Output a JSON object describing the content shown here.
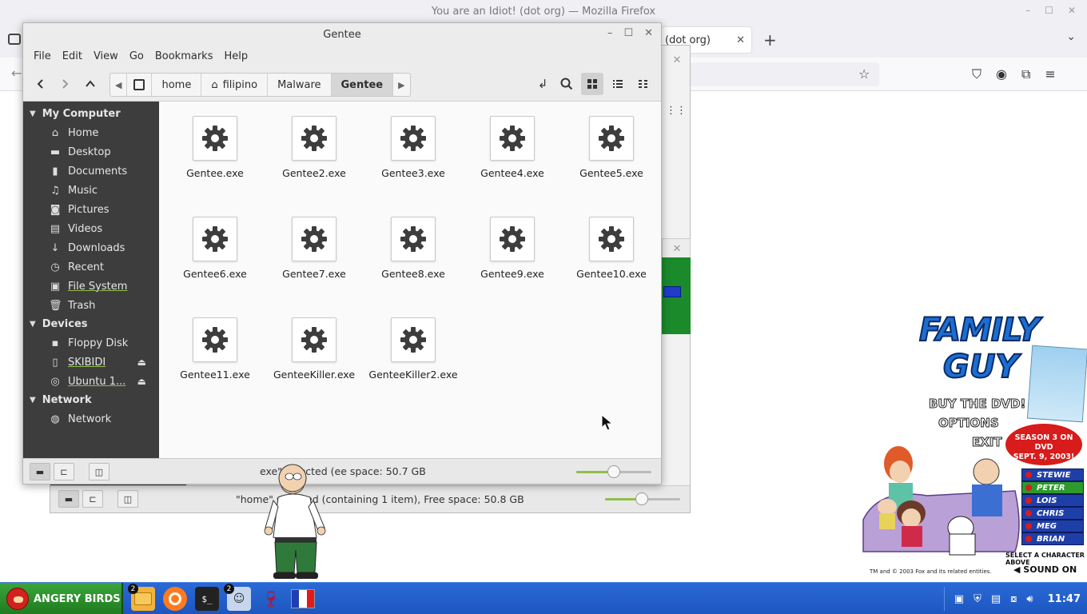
{
  "firefox": {
    "title": "You are an Idiot! (dot org) — Mozilla Firefox",
    "tab_label": "(dot org)",
    "win_controls": [
      "–",
      "☐",
      "✕"
    ]
  },
  "background_fm": {
    "status": "\"home\" selected (containing 1 item), Free space: 50.8 GB"
  },
  "fm": {
    "title": "Gentee",
    "menu": [
      "File",
      "Edit",
      "View",
      "Go",
      "Bookmarks",
      "Help"
    ],
    "breadcrumbs": [
      "home",
      "filipino",
      "Malware",
      "Gentee"
    ],
    "sidebar": {
      "sections": [
        {
          "title": "My Computer",
          "items": [
            {
              "label": "Home",
              "icon": "home-icon"
            },
            {
              "label": "Desktop",
              "icon": "desktop-icon"
            },
            {
              "label": "Documents",
              "icon": "document-icon"
            },
            {
              "label": "Music",
              "icon": "music-icon"
            },
            {
              "label": "Pictures",
              "icon": "camera-icon"
            },
            {
              "label": "Videos",
              "icon": "film-icon"
            },
            {
              "label": "Downloads",
              "icon": "download-icon"
            },
            {
              "label": "Recent",
              "icon": "clock-icon"
            },
            {
              "label": "File System",
              "icon": "drive-icon"
            },
            {
              "label": "Trash",
              "icon": "trash-icon"
            }
          ]
        },
        {
          "title": "Devices",
          "items": [
            {
              "label": "Floppy Disk",
              "icon": "floppy-icon"
            },
            {
              "label": "SKIBIDI",
              "icon": "usb-icon"
            },
            {
              "label": "Ubuntu 1...",
              "icon": "disc-icon"
            }
          ]
        },
        {
          "title": "Network",
          "items": [
            {
              "label": "Network",
              "icon": "globe-icon"
            }
          ]
        }
      ]
    },
    "files": [
      "Gentee.exe",
      "Gentee2.exe",
      "Gentee3.exe",
      "Gentee4.exe",
      "Gentee5.exe",
      "Gentee6.exe",
      "Gentee7.exe",
      "Gentee8.exe",
      "Gentee9.exe",
      "Gentee10.exe",
      "Gentee11.exe",
      "GenteeKiller.exe",
      "GenteeKiller2.exe"
    ],
    "status": "exe\" selected (ee space: 50.7 GB",
    "zoom_level": 0.5
  },
  "family_guy_ad": {
    "title_line1": "FAMILY",
    "title_line2": "GUY",
    "buy_dvd": "BUY THE DVD!",
    "options": "OPTIONS",
    "exit": "EXIT",
    "season_line1": "SEASON 3 ON DVD",
    "season_line2": "SEPT. 9, 2003!",
    "characters": [
      "STEWIE",
      "PETER",
      "LOIS",
      "CHRIS",
      "MEG",
      "BRIAN"
    ],
    "selected_character": "PETER",
    "select_prompt": "SELECT A CHARACTER ABOVE",
    "sound": "SOUND ON",
    "copyright": "TM and © 2003 Fox and its related entities."
  },
  "taskbar": {
    "start_label": "ANGERY BIRDS",
    "badges": {
      "files": "2",
      "terminal": "2"
    },
    "clock": "11:47",
    "colors": {
      "bar": "#1d56c0",
      "start": "#2e8f2e"
    }
  }
}
